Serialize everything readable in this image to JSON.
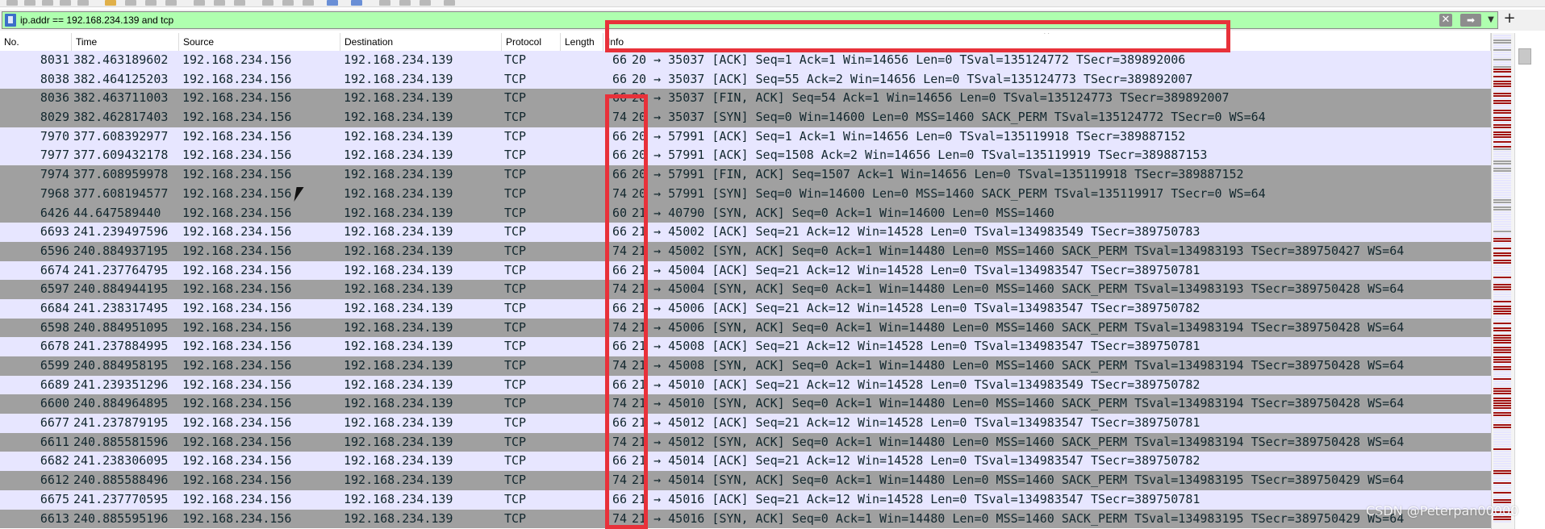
{
  "filter": {
    "value": "ip.addr == 192.168.234.139 and tcp"
  },
  "columns": [
    {
      "key": "no",
      "label": "No."
    },
    {
      "key": "time",
      "label": "Time"
    },
    {
      "key": "src",
      "label": "Source"
    },
    {
      "key": "dst",
      "label": "Destination"
    },
    {
      "key": "proto",
      "label": "Protocol"
    },
    {
      "key": "len",
      "label": "Length"
    },
    {
      "key": "info",
      "label": "Info"
    }
  ],
  "colors": {
    "filter_bg": "#afffaf",
    "row_light": "#e7e6ff",
    "row_dark": "#a0a0a0",
    "annotation": "#e8313a"
  },
  "icons": {
    "bookmark": "bookmark-icon",
    "clear": "clear-filter-icon",
    "apply": "apply-filter-icon",
    "dropdown": "filter-dropdown-icon",
    "add": "add-filter-icon",
    "sort": "sort-indicator-icon"
  },
  "rows": [
    {
      "no": "8031",
      "time": "382.463189602",
      "src": "192.168.234.156",
      "dst": "192.168.234.139",
      "proto": "TCP",
      "len": "66",
      "info": "20 → 35037 [ACK] Seq=1 Ack=1 Win=14656 Len=0 TSval=135124772 TSecr=389892006",
      "shade": "light"
    },
    {
      "no": "8038",
      "time": "382.464125203",
      "src": "192.168.234.156",
      "dst": "192.168.234.139",
      "proto": "TCP",
      "len": "66",
      "info": "20 → 35037 [ACK] Seq=55 Ack=2 Win=14656 Len=0 TSval=135124773 TSecr=389892007",
      "shade": "light"
    },
    {
      "no": "8036",
      "time": "382.463711003",
      "src": "192.168.234.156",
      "dst": "192.168.234.139",
      "proto": "TCP",
      "len": "66",
      "info": "20 → 35037 [FIN, ACK] Seq=54 Ack=1 Win=14656 Len=0 TSval=135124773 TSecr=389892007",
      "shade": "dark"
    },
    {
      "no": "8029",
      "time": "382.462817403",
      "src": "192.168.234.156",
      "dst": "192.168.234.139",
      "proto": "TCP",
      "len": "74",
      "info": "20 → 35037 [SYN] Seq=0 Win=14600 Len=0 MSS=1460 SACK_PERM TSval=135124772 TSecr=0 WS=64",
      "shade": "dark"
    },
    {
      "no": "7970",
      "time": "377.608392977",
      "src": "192.168.234.156",
      "dst": "192.168.234.139",
      "proto": "TCP",
      "len": "66",
      "info": "20 → 57991 [ACK] Seq=1 Ack=1 Win=14656 Len=0 TSval=135119918 TSecr=389887152",
      "shade": "light"
    },
    {
      "no": "7977",
      "time": "377.609432178",
      "src": "192.168.234.156",
      "dst": "192.168.234.139",
      "proto": "TCP",
      "len": "66",
      "info": "20 → 57991 [ACK] Seq=1508 Ack=2 Win=14656 Len=0 TSval=135119919 TSecr=389887153",
      "shade": "light"
    },
    {
      "no": "7974",
      "time": "377.608959978",
      "src": "192.168.234.156",
      "dst": "192.168.234.139",
      "proto": "TCP",
      "len": "66",
      "info": "20 → 57991 [FIN, ACK] Seq=1507 Ack=1 Win=14656 Len=0 TSval=135119918 TSecr=389887152",
      "shade": "dark"
    },
    {
      "no": "7968",
      "time": "377.608194577",
      "src": "192.168.234.156",
      "dst": "192.168.234.139",
      "proto": "TCP",
      "len": "74",
      "info": "20 → 57991 [SYN] Seq=0 Win=14600 Len=0 MSS=1460 SACK_PERM TSval=135119917 TSecr=0 WS=64",
      "shade": "dark"
    },
    {
      "no": "6426",
      "time": "44.647589440",
      "src": "192.168.234.156",
      "dst": "192.168.234.139",
      "proto": "TCP",
      "len": "60",
      "info": "21 → 40790 [SYN, ACK] Seq=0 Ack=1 Win=14600 Len=0 MSS=1460",
      "shade": "dark"
    },
    {
      "no": "6693",
      "time": "241.239497596",
      "src": "192.168.234.156",
      "dst": "192.168.234.139",
      "proto": "TCP",
      "len": "66",
      "info": "21 → 45002 [ACK] Seq=21 Ack=12 Win=14528 Len=0 TSval=134983549 TSecr=389750783",
      "shade": "light"
    },
    {
      "no": "6596",
      "time": "240.884937195",
      "src": "192.168.234.156",
      "dst": "192.168.234.139",
      "proto": "TCP",
      "len": "74",
      "info": "21 → 45002 [SYN, ACK] Seq=0 Ack=1 Win=14480 Len=0 MSS=1460 SACK_PERM TSval=134983193 TSecr=389750427 WS=64",
      "shade": "dark"
    },
    {
      "no": "6674",
      "time": "241.237764795",
      "src": "192.168.234.156",
      "dst": "192.168.234.139",
      "proto": "TCP",
      "len": "66",
      "info": "21 → 45004 [ACK] Seq=21 Ack=12 Win=14528 Len=0 TSval=134983547 TSecr=389750781",
      "shade": "light"
    },
    {
      "no": "6597",
      "time": "240.884944195",
      "src": "192.168.234.156",
      "dst": "192.168.234.139",
      "proto": "TCP",
      "len": "74",
      "info": "21 → 45004 [SYN, ACK] Seq=0 Ack=1 Win=14480 Len=0 MSS=1460 SACK_PERM TSval=134983193 TSecr=389750428 WS=64",
      "shade": "dark"
    },
    {
      "no": "6684",
      "time": "241.238317495",
      "src": "192.168.234.156",
      "dst": "192.168.234.139",
      "proto": "TCP",
      "len": "66",
      "info": "21 → 45006 [ACK] Seq=21 Ack=12 Win=14528 Len=0 TSval=134983547 TSecr=389750782",
      "shade": "light"
    },
    {
      "no": "6598",
      "time": "240.884951095",
      "src": "192.168.234.156",
      "dst": "192.168.234.139",
      "proto": "TCP",
      "len": "74",
      "info": "21 → 45006 [SYN, ACK] Seq=0 Ack=1 Win=14480 Len=0 MSS=1460 SACK_PERM TSval=134983194 TSecr=389750428 WS=64",
      "shade": "dark"
    },
    {
      "no": "6678",
      "time": "241.237884995",
      "src": "192.168.234.156",
      "dst": "192.168.234.139",
      "proto": "TCP",
      "len": "66",
      "info": "21 → 45008 [ACK] Seq=21 Ack=12 Win=14528 Len=0 TSval=134983547 TSecr=389750781",
      "shade": "light"
    },
    {
      "no": "6599",
      "time": "240.884958195",
      "src": "192.168.234.156",
      "dst": "192.168.234.139",
      "proto": "TCP",
      "len": "74",
      "info": "21 → 45008 [SYN, ACK] Seq=0 Ack=1 Win=14480 Len=0 MSS=1460 SACK_PERM TSval=134983194 TSecr=389750428 WS=64",
      "shade": "dark"
    },
    {
      "no": "6689",
      "time": "241.239351296",
      "src": "192.168.234.156",
      "dst": "192.168.234.139",
      "proto": "TCP",
      "len": "66",
      "info": "21 → 45010 [ACK] Seq=21 Ack=12 Win=14528 Len=0 TSval=134983549 TSecr=389750782",
      "shade": "light"
    },
    {
      "no": "6600",
      "time": "240.884964895",
      "src": "192.168.234.156",
      "dst": "192.168.234.139",
      "proto": "TCP",
      "len": "74",
      "info": "21 → 45010 [SYN, ACK] Seq=0 Ack=1 Win=14480 Len=0 MSS=1460 SACK_PERM TSval=134983194 TSecr=389750428 WS=64",
      "shade": "dark"
    },
    {
      "no": "6677",
      "time": "241.237879195",
      "src": "192.168.234.156",
      "dst": "192.168.234.139",
      "proto": "TCP",
      "len": "66",
      "info": "21 → 45012 [ACK] Seq=21 Ack=12 Win=14528 Len=0 TSval=134983547 TSecr=389750781",
      "shade": "light"
    },
    {
      "no": "6611",
      "time": "240.885581596",
      "src": "192.168.234.156",
      "dst": "192.168.234.139",
      "proto": "TCP",
      "len": "74",
      "info": "21 → 45012 [SYN, ACK] Seq=0 Ack=1 Win=14480 Len=0 MSS=1460 SACK_PERM TSval=134983194 TSecr=389750428 WS=64",
      "shade": "dark"
    },
    {
      "no": "6682",
      "time": "241.238306095",
      "src": "192.168.234.156",
      "dst": "192.168.234.139",
      "proto": "TCP",
      "len": "66",
      "info": "21 → 45014 [ACK] Seq=21 Ack=12 Win=14528 Len=0 TSval=134983547 TSecr=389750782",
      "shade": "light"
    },
    {
      "no": "6612",
      "time": "240.885588496",
      "src": "192.168.234.156",
      "dst": "192.168.234.139",
      "proto": "TCP",
      "len": "74",
      "info": "21 → 45014 [SYN, ACK] Seq=0 Ack=1 Win=14480 Len=0 MSS=1460 SACK_PERM TSval=134983195 TSecr=389750429 WS=64",
      "shade": "dark"
    },
    {
      "no": "6675",
      "time": "241.237770595",
      "src": "192.168.234.156",
      "dst": "192.168.234.139",
      "proto": "TCP",
      "len": "66",
      "info": "21 → 45016 [ACK] Seq=21 Ack=12 Win=14528 Len=0 TSval=134983547 TSecr=389750781",
      "shade": "light"
    },
    {
      "no": "6613",
      "time": "240.885595196",
      "src": "192.168.234.156",
      "dst": "192.168.234.139",
      "proto": "TCP",
      "len": "74",
      "info": "21 → 45016 [SYN, ACK] Seq=0 Ack=1 Win=14480 Len=0 MSS=1460 SACK_PERM TSval=134983195 TSecr=389750429 WS=64",
      "shade": "dark"
    }
  ],
  "watermark": "CSDN @Peterpan00000"
}
